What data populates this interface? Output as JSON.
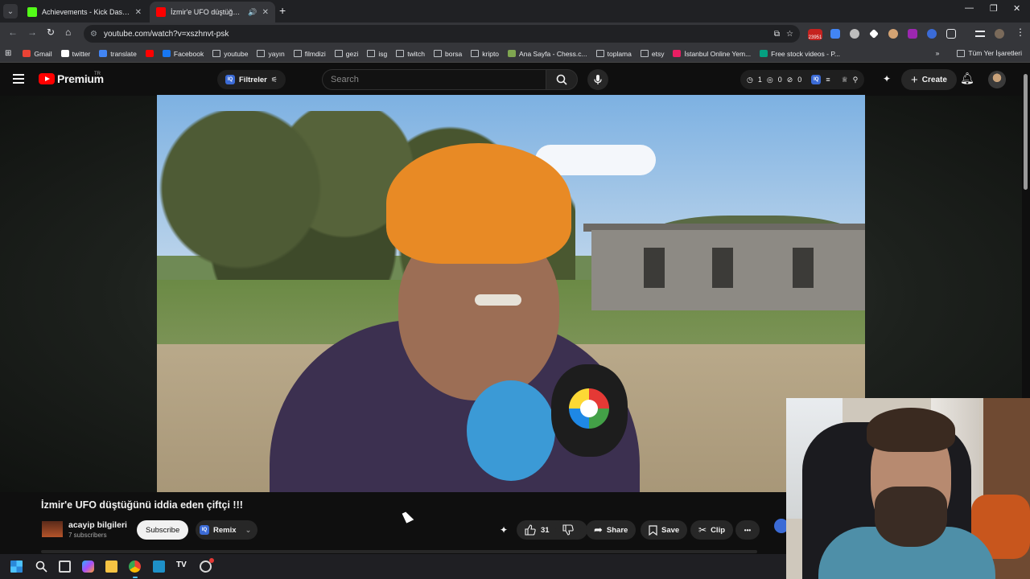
{
  "browser": {
    "tabs": [
      {
        "title": "Achievements - Kick Dashboard",
        "favicon_color": "#53fc18",
        "active": false
      },
      {
        "title": "İzmir'e UFO düştüğünü idd",
        "favicon_color": "#ff0000",
        "active": true
      }
    ],
    "new_tab": "+",
    "url": "youtube.com/watch?v=xszhnvt-psk",
    "extension_badge": "23951",
    "bookmarks": [
      {
        "label": "Gmail",
        "icon": "gmail-icon",
        "color": "#ea4335"
      },
      {
        "label": "twitter",
        "icon": "x-icon",
        "color": "#ffffff"
      },
      {
        "label": "translate",
        "icon": "translate-icon",
        "color": "#4285f4"
      },
      {
        "label": "",
        "icon": "youtube-icon",
        "color": "#ff0000"
      },
      {
        "label": "Facebook",
        "icon": "facebook-icon",
        "color": "#1877f2"
      },
      {
        "label": "youtube",
        "icon": "folder-icon",
        "color": ""
      },
      {
        "label": "yayın",
        "icon": "folder-icon",
        "color": ""
      },
      {
        "label": "filmdizi",
        "icon": "folder-icon",
        "color": ""
      },
      {
        "label": "gezi",
        "icon": "folder-icon",
        "color": ""
      },
      {
        "label": "isg",
        "icon": "folder-icon",
        "color": ""
      },
      {
        "label": "twitch",
        "icon": "folder-icon",
        "color": ""
      },
      {
        "label": "borsa",
        "icon": "folder-icon",
        "color": ""
      },
      {
        "label": "kripto",
        "icon": "folder-icon",
        "color": ""
      },
      {
        "label": "Ana Sayfa - Chess.c...",
        "icon": "chess-icon",
        "color": "#7fa650"
      },
      {
        "label": "toplama",
        "icon": "folder-icon",
        "color": ""
      },
      {
        "label": "etsy",
        "icon": "folder-icon",
        "color": ""
      },
      {
        "label": "İstanbul Online Yem...",
        "icon": "yemeksepeti-icon",
        "color": "#e91e63"
      },
      {
        "label": "Free stock videos - P...",
        "icon": "pexels-icon",
        "color": "#05a081"
      }
    ],
    "bookmarks_overflow": "»",
    "all_bookmarks": "Tüm Yer İşaretleri"
  },
  "youtube": {
    "logo_text": "Premium",
    "region": "TR",
    "filter_label": "Filtreler",
    "search_placeholder": "Search",
    "stats": {
      "a": "1",
      "b": "0",
      "c": "0"
    },
    "create_label": "Create",
    "video": {
      "title": "İzmir'e UFO düştüğünü iddia eden çiftçi !!!",
      "channel": "acayip bilgileri",
      "subscribers": "7 subscribers",
      "subscribe_label": "Subscribe",
      "remix_label": "Remix",
      "likes": "31",
      "share_label": "Share",
      "save_label": "Save",
      "clip_label": "Clip",
      "more_label": "•••"
    }
  },
  "colors": {
    "accent_red": "#ff0000",
    "bg": "#0f0f0f",
    "pill": "#272727"
  }
}
